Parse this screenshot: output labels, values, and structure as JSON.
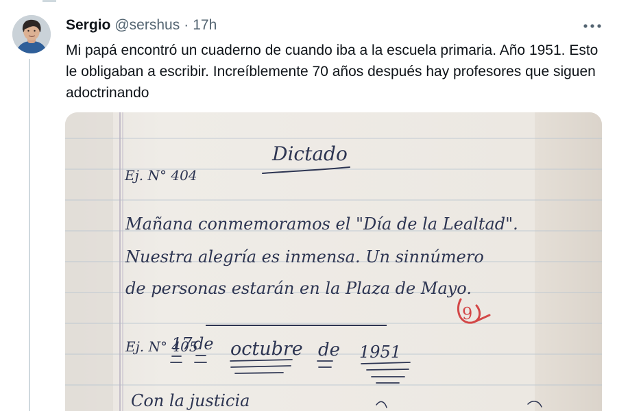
{
  "author": {
    "display_name": "Sergio",
    "handle": "@sershus",
    "separator": "·",
    "time": "17h"
  },
  "more_icon": "more-horizontal-icon",
  "tweet_text": "Mi papá encontró un cuaderno de cuando iba a la escuela primaria. Año 1951. Esto le obligaban a escribir. Increíblemente 70 años después hay profesores que siguen adoctrinando",
  "media": {
    "notebook": {
      "exercise_label_1": "Ej. N° 404",
      "title": "Dictado",
      "line_1": "Mañana conmemoramos el \"Día de la Lealtad\".",
      "line_2": "Nuestra alegría es inmensa. Un sinnúmero",
      "line_3": "de personas estarán en la Plaza de Mayo.",
      "grade_mark": "9",
      "exercise_label_2": "Ej. N° 405",
      "date_day": "17",
      "date_de_1": "de",
      "date_month": "octubre",
      "date_de_2": "de",
      "date_year": "1951",
      "line_4": "Con la justicia"
    }
  },
  "colors": {
    "text_primary": "#0f1419",
    "text_secondary": "#536471",
    "divider": "#cfd9de",
    "paper": "#eeeae3",
    "ruling": "#a8b6c4",
    "ink": "#2d3552",
    "red_ink": "#d34747"
  }
}
